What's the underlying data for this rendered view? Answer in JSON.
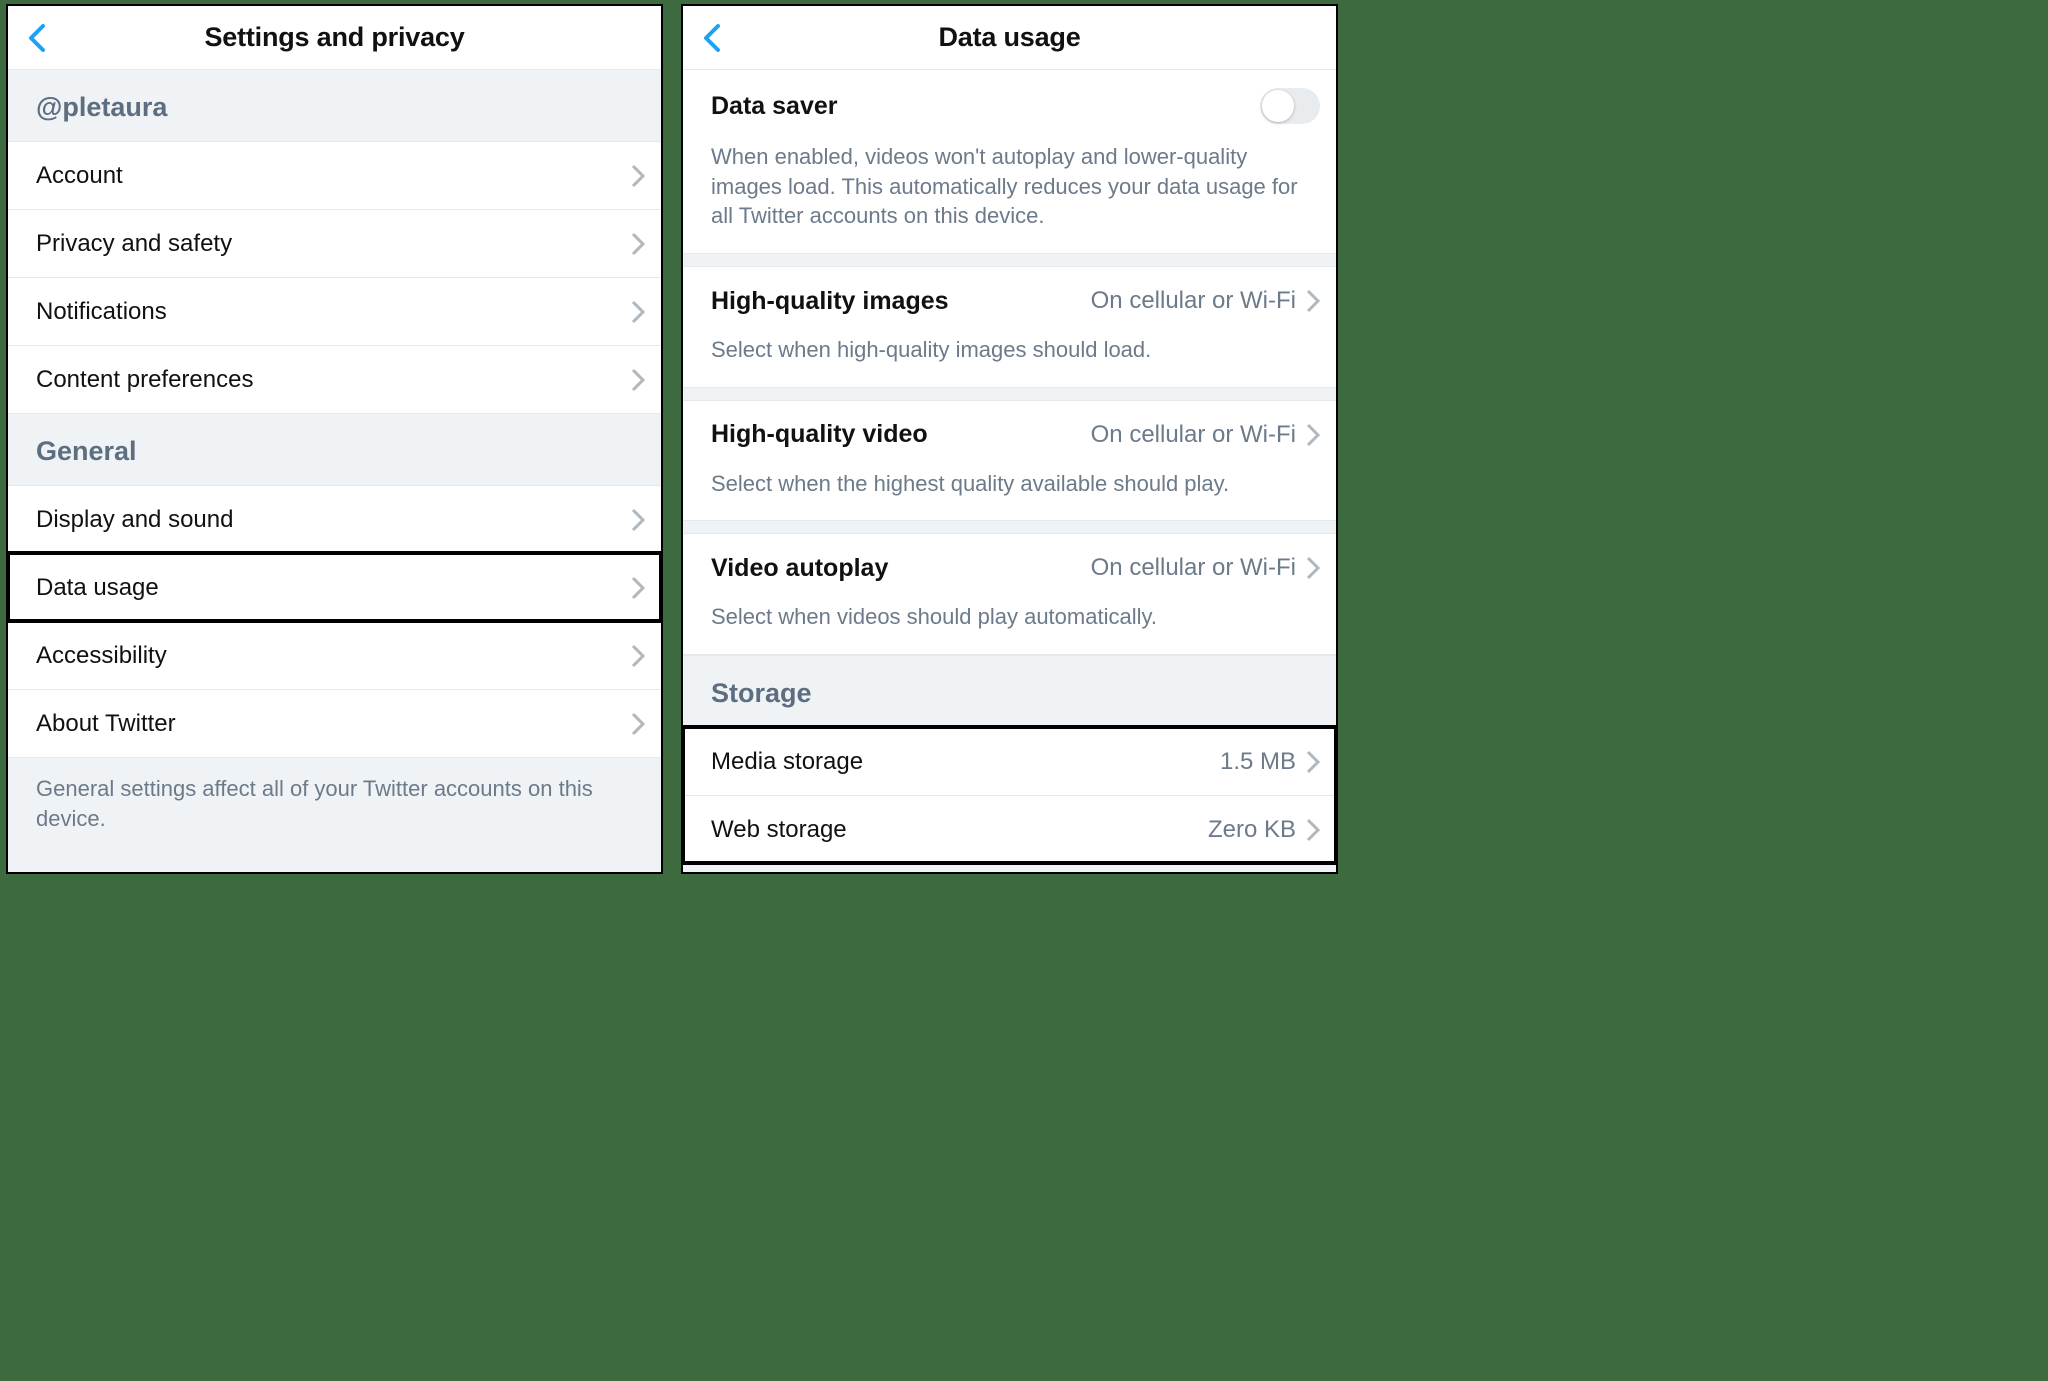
{
  "left": {
    "title": "Settings and privacy",
    "user_header": "@pletaura",
    "account_items": [
      {
        "label": "Account"
      },
      {
        "label": "Privacy and safety"
      },
      {
        "label": "Notifications"
      },
      {
        "label": "Content preferences"
      }
    ],
    "general_header": "General",
    "general_items": [
      {
        "label": "Display and sound"
      },
      {
        "label": "Data usage"
      },
      {
        "label": "Accessibility"
      },
      {
        "label": "About Twitter"
      }
    ],
    "general_hint": "General settings affect all of your Twitter accounts on this device."
  },
  "right": {
    "title": "Data usage",
    "data_saver": {
      "label": "Data saver",
      "hint": "When enabled, videos won't autoplay and lower-quality images load. This automatically reduces your data usage for all Twitter accounts on this device.",
      "enabled": false
    },
    "hq_images": {
      "label": "High-quality images",
      "value": "On cellular or Wi-Fi",
      "hint": "Select when high-quality images should load."
    },
    "hq_video": {
      "label": "High-quality video",
      "value": "On cellular or Wi-Fi",
      "hint": "Select when the highest quality available should play."
    },
    "autoplay": {
      "label": "Video autoplay",
      "value": "On cellular or Wi-Fi",
      "hint": "Select when videos should play automatically."
    },
    "storage_header": "Storage",
    "storage_items": [
      {
        "label": "Media storage",
        "value": "1.5 MB"
      },
      {
        "label": "Web storage",
        "value": "Zero KB"
      }
    ]
  }
}
